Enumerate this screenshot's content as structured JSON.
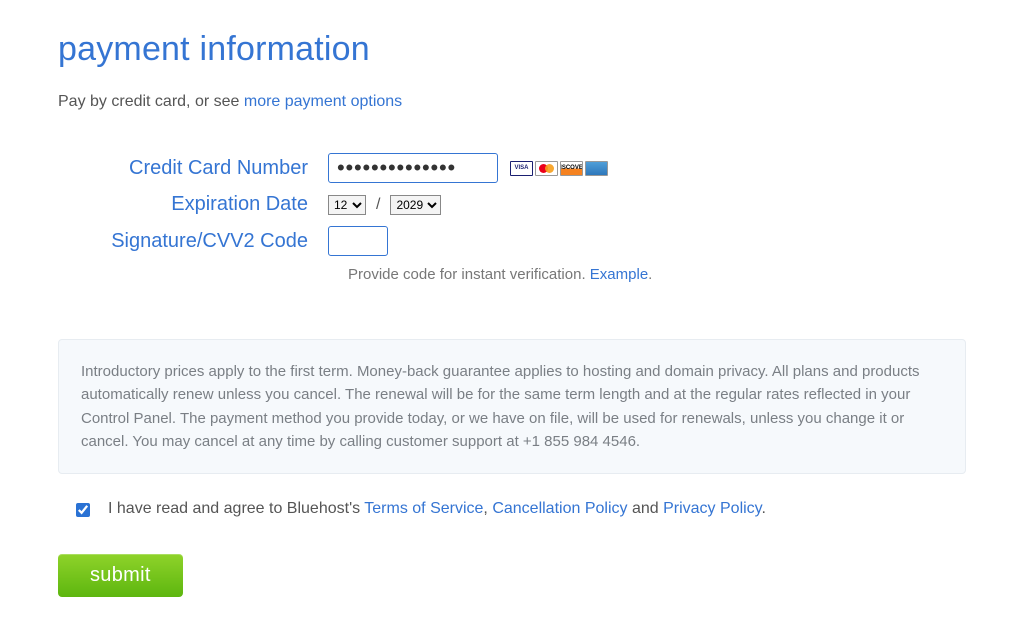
{
  "title": "payment information",
  "intro_prefix": "Pay by credit card, or see ",
  "intro_link": "more payment options",
  "fields": {
    "card_label": "Credit Card Number",
    "card_value": "••••••••••••••",
    "exp_label": "Expiration Date",
    "exp_month": "12",
    "exp_year": "2029",
    "cvv_label": "Signature/CVV2 Code",
    "cvv_value": ""
  },
  "card_brands": {
    "visa": "VISA",
    "mc": "",
    "disc": "DISCOVER",
    "amex": ""
  },
  "cvv_hint_prefix": "Provide code for instant verification. ",
  "cvv_hint_link": "Example",
  "cvv_hint_suffix": ".",
  "notice": "Introductory prices apply to the first term. Money-back guarantee applies to hosting and domain privacy. All plans and products automatically renew unless you cancel. The renewal will be for the same term length and at the regular rates reflected in your Control Panel. The payment method you provide today, or we have on file, will be used for renewals, unless you change it or cancel. You may cancel at any time by calling customer support at +1 855 984 4546.",
  "agree": {
    "prefix": "I have read and agree to Bluehost's ",
    "tos": "Terms of Service",
    "sep1": ", ",
    "cancel": "Cancellation Policy",
    "sep2": " and ",
    "privacy": "Privacy Policy",
    "suffix": "."
  },
  "submit_label": "submit"
}
